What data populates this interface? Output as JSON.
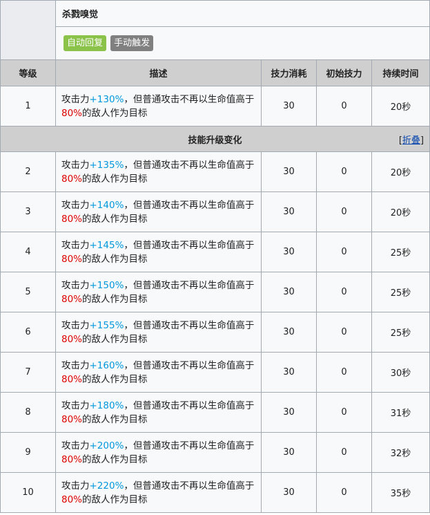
{
  "skill": {
    "name": "杀戮嗅觉",
    "tags": [
      "自动回复",
      "手动触发"
    ]
  },
  "headers": [
    "等级",
    "描述",
    "技力消耗",
    "初始技力",
    "持续时间"
  ],
  "upgrade_label": "技能升级变化",
  "fold_label": "折叠",
  "rows": [
    {
      "level": "1",
      "pre": "攻击力",
      "atk": "+130%",
      "mid": "，但普通攻击不再以生命值高于",
      "hp": "80%",
      "post": "的敌人作为目标",
      "cost": "30",
      "init": "0",
      "dur": "20秒"
    },
    {
      "level": "2",
      "pre": "攻击力",
      "atk": "+135%",
      "mid": "，但普通攻击不再以生命值高于",
      "hp": "80%",
      "post": "的敌人作为目标",
      "cost": "30",
      "init": "0",
      "dur": "20秒"
    },
    {
      "level": "3",
      "pre": "攻击力",
      "atk": "+140%",
      "mid": "，但普通攻击不再以生命值高于",
      "hp": "80%",
      "post": "的敌人作为目标",
      "cost": "30",
      "init": "0",
      "dur": "20秒"
    },
    {
      "level": "4",
      "pre": "攻击力",
      "atk": "+145%",
      "mid": "，但普通攻击不再以生命值高于",
      "hp": "80%",
      "post": "的敌人作为目标",
      "cost": "30",
      "init": "0",
      "dur": "25秒"
    },
    {
      "level": "5",
      "pre": "攻击力",
      "atk": "+150%",
      "mid": "，但普通攻击不再以生命值高于",
      "hp": "80%",
      "post": "的敌人作为目标",
      "cost": "30",
      "init": "0",
      "dur": "25秒"
    },
    {
      "level": "6",
      "pre": "攻击力",
      "atk": "+155%",
      "mid": "，但普通攻击不再以生命值高于",
      "hp": "80%",
      "post": "的敌人作为目标",
      "cost": "30",
      "init": "0",
      "dur": "25秒"
    },
    {
      "level": "7",
      "pre": "攻击力",
      "atk": "+160%",
      "mid": "，但普通攻击不再以生命值高于",
      "hp": "80%",
      "post": "的敌人作为目标",
      "cost": "30",
      "init": "0",
      "dur": "30秒"
    },
    {
      "level": "8",
      "pre": "攻击力",
      "atk": "+180%",
      "mid": "，但普通攻击不再以生命值高于",
      "hp": "80%",
      "post": "的敌人作为目标",
      "cost": "30",
      "init": "0",
      "dur": "31秒"
    },
    {
      "level": "9",
      "pre": "攻击力",
      "atk": "+200%",
      "mid": "，但普通攻击不再以生命值高于",
      "hp": "80%",
      "post": "的敌人作为目标",
      "cost": "30",
      "init": "0",
      "dur": "32秒"
    },
    {
      "level": "10",
      "pre": "攻击力",
      "atk": "+220%",
      "mid": "，但普通攻击不再以生命值高于",
      "hp": "80%",
      "post": "的敌人作为目标",
      "cost": "30",
      "init": "0",
      "dur": "35秒"
    }
  ]
}
